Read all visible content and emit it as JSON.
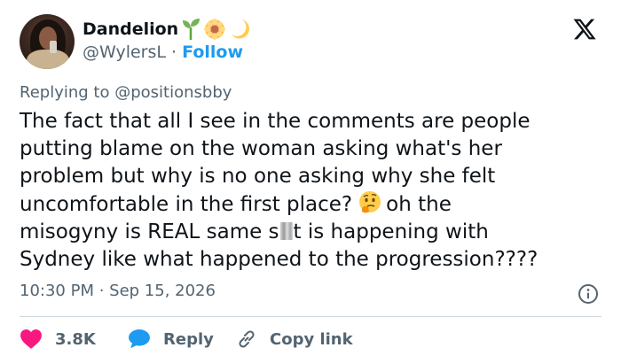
{
  "author": {
    "display_name": "Dandelion",
    "handle": "@WylersL",
    "separator": "·",
    "follow_label": "Follow",
    "name_emojis": [
      "seedling-icon",
      "sunflower-icon",
      "crescent-moon-icon"
    ]
  },
  "reply_to": {
    "prefix": "Replying to",
    "mention": "@positionsbby"
  },
  "tweet": {
    "line1": "The fact that all I see in the comments are people",
    "line2": "putting blame on the woman asking what's her",
    "line3": "problem but why is no one asking why she felt",
    "line4_a": "uncomfortable in the first place?",
    "line4_b": "oh the",
    "line5_a": "misogyny is REAL same s",
    "line5_b": "t is happening with",
    "line6": "Sydney like what happened to the progression????"
  },
  "meta": {
    "timestamp": "10:30 PM · Sep 15, 2026"
  },
  "actions": {
    "like_count": "3.8K",
    "reply_label": "Reply",
    "copy_label": "Copy link"
  },
  "colors": {
    "text": "#0f1419",
    "secondary": "#536471",
    "accent": "#1d9bf0",
    "like": "#f91880",
    "divider": "#cfd9de"
  }
}
